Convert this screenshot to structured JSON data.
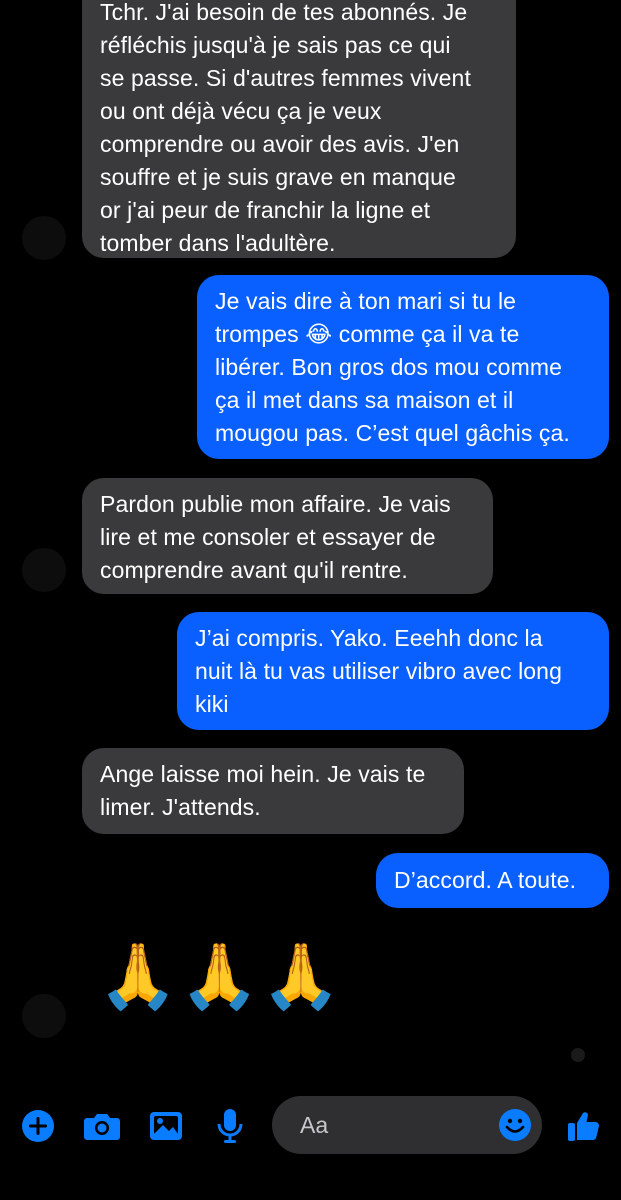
{
  "messages": [
    {
      "side": "in",
      "text": "Tchr. J'ai besoin de tes abonnés. Je\nréfléchis jusqu'à je sais pas ce qui\nse passe. Si d'autres femmes vivent\nou ont déjà vécu ça je veux\ncomprendre ou avoir des avis. J'en\nsouffre et je suis grave en manque\nor j'ai peur de franchir la ligne et\ntomber dans l'adultère."
    },
    {
      "side": "out",
      "text": "Je vais dire à ton mari si tu le\ntrompes 😂 comme ça il va te\nlibérer. Bon gros dos mou comme\nça il met dans sa maison et il\nmougou pas. C’est quel gâchis ça."
    },
    {
      "side": "in",
      "text": "Pardon publie mon affaire. Je vais\nlire et me consoler et essayer de\ncomprendre avant qu'il rentre."
    },
    {
      "side": "out",
      "text": "J’ai compris. Yako. Eeehh donc la\nnuit là tu vas utiliser vibro avec long\nkiki"
    },
    {
      "side": "in",
      "text": "Ange laisse moi hein. Je vais te\nlimer. J'attends."
    },
    {
      "side": "out",
      "text": "D’accord. A toute."
    }
  ],
  "emoji_message": "🙏🙏🙏",
  "composer": {
    "placeholder": "Aa",
    "icons": [
      "plus-icon",
      "camera-icon",
      "image-icon",
      "microphone-icon",
      "emoji-icon",
      "thumbs-up-icon"
    ]
  },
  "colors": {
    "background": "#000000",
    "incoming_bubble": "#3a3a3c",
    "outgoing_bubble": "#0a60ff",
    "accent": "#0a7cff"
  }
}
